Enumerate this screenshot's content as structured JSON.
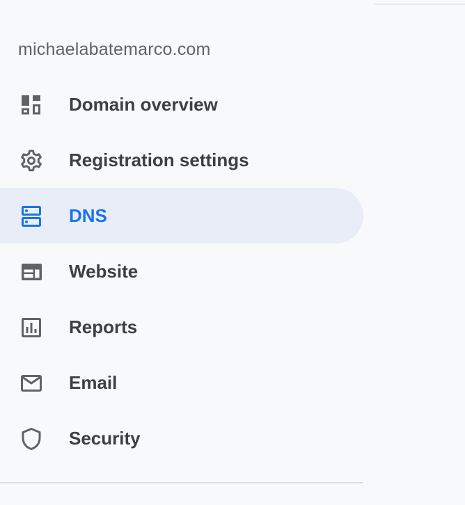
{
  "domain": "michaelabatemarco.com",
  "nav": {
    "items": [
      {
        "label": "Domain overview",
        "icon": "dashboard-icon",
        "active": false
      },
      {
        "label": "Registration settings",
        "icon": "gear-icon",
        "active": false
      },
      {
        "label": "DNS",
        "icon": "dns-icon",
        "active": true
      },
      {
        "label": "Website",
        "icon": "web-icon",
        "active": false
      },
      {
        "label": "Reports",
        "icon": "bar-chart-icon",
        "active": false
      },
      {
        "label": "Email",
        "icon": "mail-icon",
        "active": false
      },
      {
        "label": "Security",
        "icon": "shield-icon",
        "active": false
      }
    ]
  },
  "colors": {
    "accent": "#1a73e8",
    "active_background": "#e8edf8",
    "text": "#3c4043",
    "icon": "#5f6368",
    "background": "#f8f9fb"
  }
}
